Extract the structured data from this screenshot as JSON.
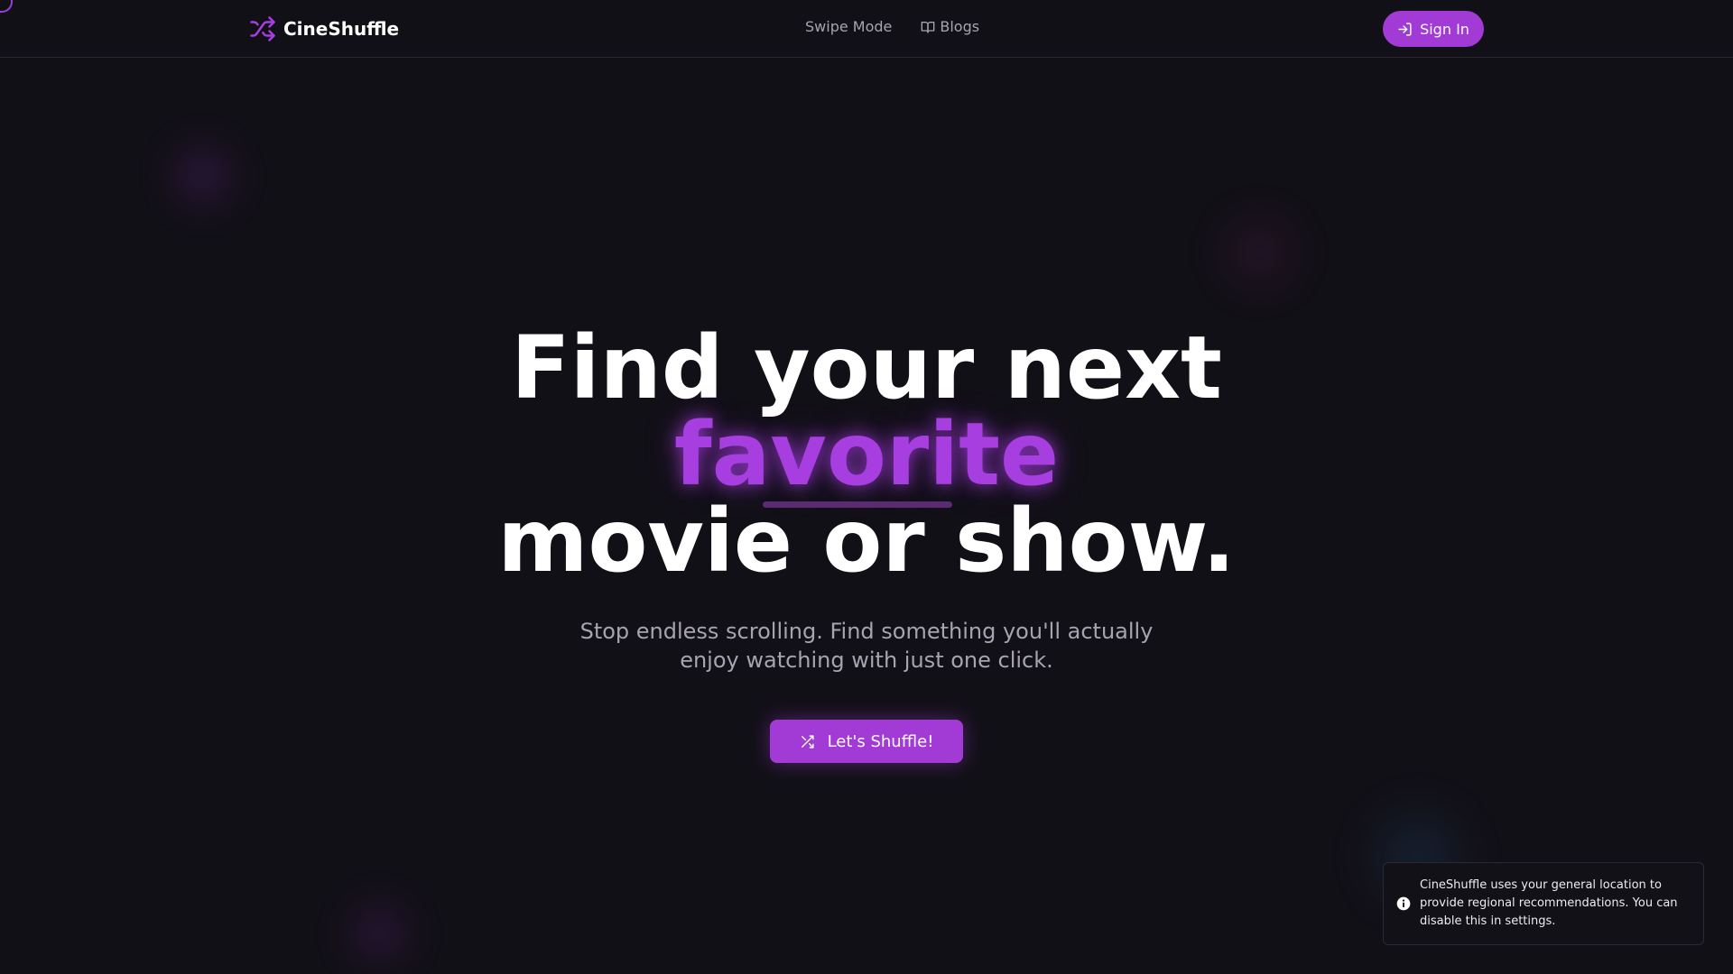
{
  "app": {
    "name": "CineShuffle",
    "accent_color": "#a23ad6",
    "background_color": "#121017"
  },
  "header": {
    "logo_icon": "shuffle-icon",
    "nav": [
      {
        "label": "Swipe Mode",
        "icon": null
      },
      {
        "label": "Blogs",
        "icon": "book-open-icon"
      }
    ],
    "signin": {
      "label": "Sign In",
      "icon": "log-in-icon"
    }
  },
  "hero": {
    "line1": "Find your next",
    "highlight": "favorite",
    "line3": "movie or show.",
    "subtitle": "Stop endless scrolling. Find something you'll actually enjoy watching with just one click.",
    "cta": {
      "label": "Let's Shuffle!",
      "icon": "shuffle-icon"
    }
  },
  "toast": {
    "icon": "info-icon",
    "message": "CineShuffle uses your general location to provide regional recommendations. You can disable this in settings."
  }
}
